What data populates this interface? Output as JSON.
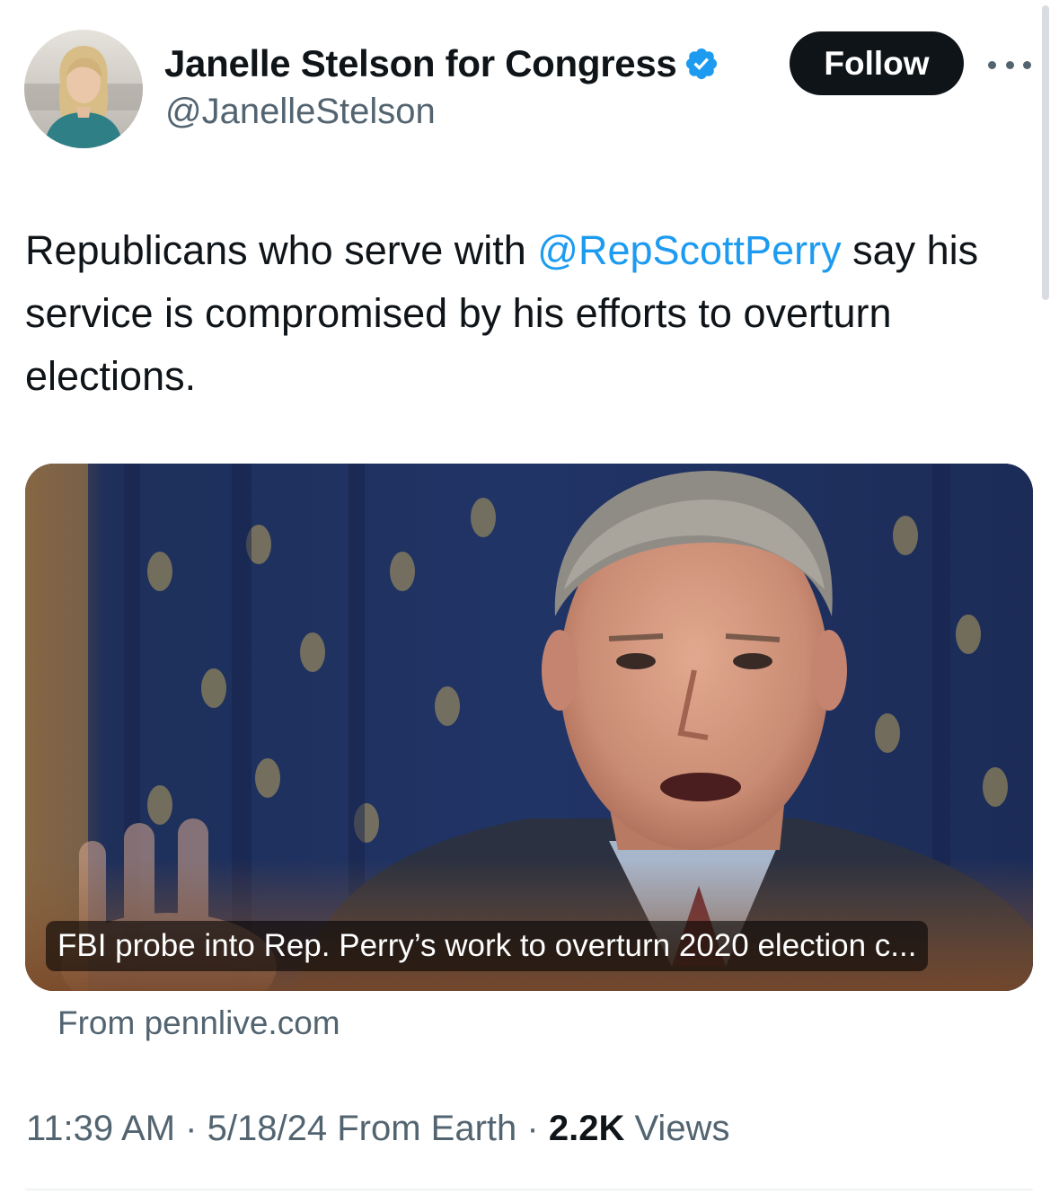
{
  "header": {
    "display_name": "Janelle Stelson for Congress",
    "handle": "@JanelleStelson",
    "follow_label": "Follow",
    "verified_color": "#1d9bf0"
  },
  "tweet": {
    "text_before": "Republicans who serve with ",
    "mention": "@RepScottPerry",
    "text_after": " say his service is compromised by his efforts to overturn elections."
  },
  "card": {
    "title": "FBI probe into Rep. Perry’s work to overturn 2020 election c...",
    "source": "From pennlive.com"
  },
  "meta": {
    "time": "11:39 AM",
    "separator": "·",
    "date": "5/18/24",
    "location": "From Earth",
    "views_count": "2.2K",
    "views_label": "Views"
  },
  "colors": {
    "text_primary": "#0f1419",
    "text_secondary": "#536471",
    "link": "#1d9bf0",
    "button_bg": "#0f1419"
  }
}
